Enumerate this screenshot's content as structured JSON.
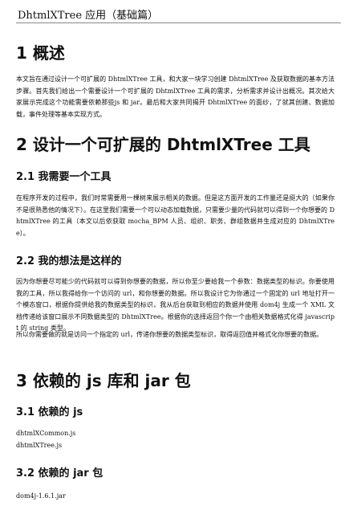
{
  "header": {
    "title": "DhtmlXTree 应用（基础篇）"
  },
  "sections": [
    {
      "title": "1 概述",
      "paragraph": "本文旨在通过设计一个可扩展的 DhtmlXTree 工具，和大家一块学习创建 DhtmlXTree 及获取数据的基本方法步骤。首先我们给出一个需要设计一个可扩展的 DhtmlXTree 工具的需求，分析需求并设计出概况。其次给大家展示完成这个功能需要依赖那些js 和 jar。最后和大家共同揭开 DhtmlXTree 的面纱，了就其创建、数据加载，事件处理等基本实现方式。"
    },
    {
      "title": "2 设计一个可扩展的 DhtmlXTree 工具",
      "subsections": [
        {
          "title": "2.1 我需要一个工具",
          "paragraph": "在程序开发的过程中，我们时常需要用一棵树来展示相关的数据。但是这方面开发的工作量还是挺大的（如果你不是很熟悉他的情况下）。在这里我们需要一个可以动态加载数据，只需要少量的代码就可以得到一个你想要的 DhtmlXTree 的工具（本文以后依获取 mocha_BPM 人员、组织、职务、群组数据并生成对应的 DhtmlXTree）。"
        },
        {
          "title": "2.2 我的想法是这样的",
          "paragraph": "因为你想要尽可能少的代码就可以得到你想要的数据，所以你至少要给我一个参数：数据类型的标识。你要使用我的工具，所以我得给你一个访问的 url，和你想要的数据。所以我设计它为你通过一个固定的 url 地址打开一个模态窗口，根据你提供给我的数据类型的标识，我从后台获取到相应的数据并使用 dom4j 生成一个 XML 文档传递给该窗口展示不同数据类型的 DhtmlXTree。根据你的选择返回个你一个由相关数据格式化得 javascript 的 string 类型。",
          "paragraph2": "所以你需要做的就是访问一个指定的 url，传递你想要的数据类型标识，取得返回值并格式化你想要的数据。"
        }
      ]
    },
    {
      "title": "3 依赖的 js 库和 jar 包",
      "subsections": [
        {
          "title": "3.1 依赖的 js",
          "items": [
            "dhtmlXCommon.js",
            "dhtmlXTree.js"
          ]
        },
        {
          "title": "3.2 依赖的 jar 包",
          "items": [
            "dom4j-1.6.1.jar"
          ]
        }
      ]
    }
  ]
}
